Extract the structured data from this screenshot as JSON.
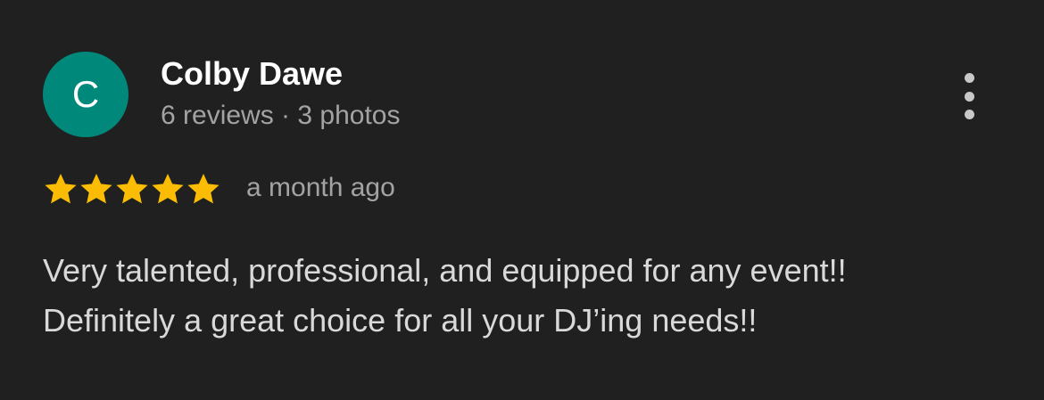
{
  "reviewer": {
    "initial": "C",
    "name": "Colby Dawe",
    "meta": "6 reviews · 3 photos",
    "avatar_color": "#00897b"
  },
  "review": {
    "rating": 5,
    "max_rating": 5,
    "star_color": "#fbbc04",
    "date": "a month ago",
    "text_lines": [
      "Very talented, professional, and equipped for any event!!",
      "Definitely a great choice for all your DJ’ing needs!!"
    ]
  },
  "actions": {
    "more_icon": "more-vert-icon"
  },
  "colors": {
    "background": "#202020",
    "name": "#ffffff",
    "secondary_text": "#a3a3a3",
    "body_text": "#d9d9d9"
  }
}
